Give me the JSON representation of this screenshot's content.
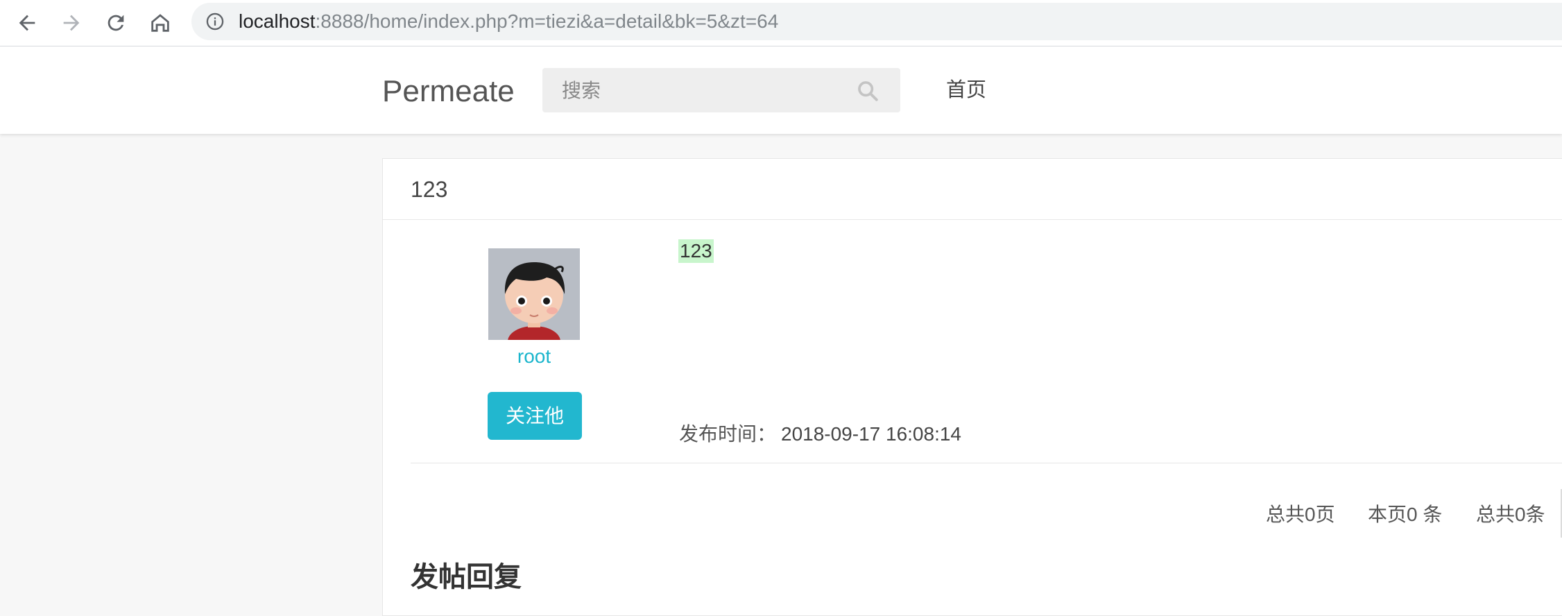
{
  "browser": {
    "url_host": "localhost",
    "url_rest": ":8888/home/index.php?m=tiezi&a=detail&bk=5&zt=64"
  },
  "header": {
    "logo": "Permeate",
    "search_placeholder": "搜索",
    "nav_home": "首页"
  },
  "post": {
    "title": "123",
    "author": {
      "name": "root",
      "follow_label": "关注他"
    },
    "content": "123",
    "publish_label": "发布时间：",
    "publish_time": "2018-09-17 16:08:14"
  },
  "pagination": {
    "total_pages": "总共0页",
    "this_page": "本页0 条",
    "total_items": "总共0条"
  },
  "reply": {
    "title": "发帖回复"
  },
  "colors": {
    "accent": "#22b7cf",
    "link": "#1ab5cc",
    "highlight": "#c8f5cc"
  }
}
